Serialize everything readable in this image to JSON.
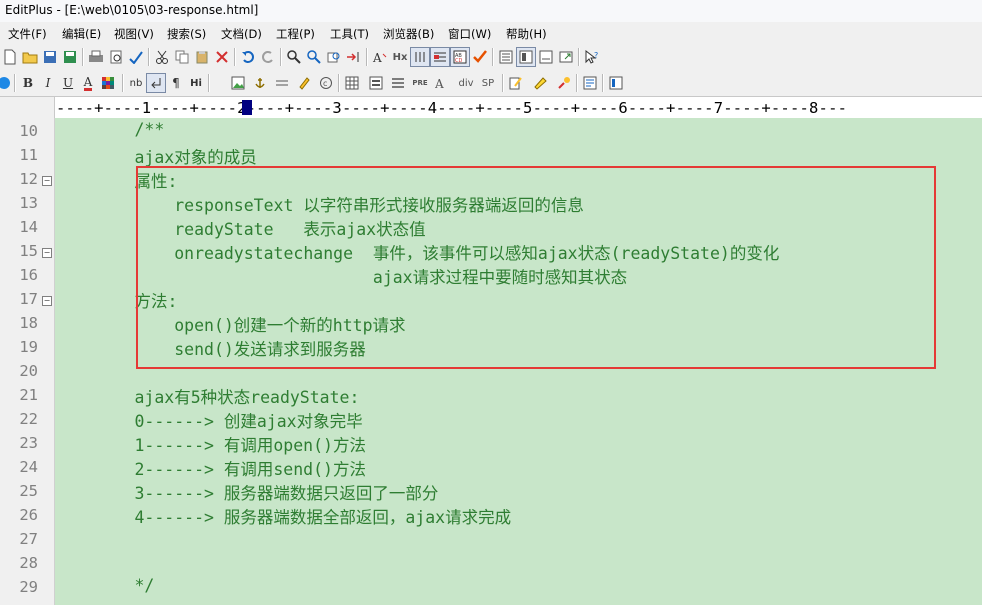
{
  "window": {
    "title": "EditPlus - [E:\\web\\0105\\03-response.html]"
  },
  "menu": [
    {
      "name": "file",
      "label": "文件(F)"
    },
    {
      "name": "edit",
      "label": "编辑(E)"
    },
    {
      "name": "view",
      "label": "视图(V)"
    },
    {
      "name": "search",
      "label": "搜索(S)"
    },
    {
      "name": "document",
      "label": "文档(D)"
    },
    {
      "name": "project",
      "label": "工程(P)"
    },
    {
      "name": "tools",
      "label": "工具(T)"
    },
    {
      "name": "browser",
      "label": "浏览器(B)"
    },
    {
      "name": "window",
      "label": "窗口(W)"
    },
    {
      "name": "help",
      "label": "帮助(H)"
    }
  ],
  "toolbar2_text": {
    "bold": "B",
    "italic": "I",
    "underline": "U",
    "color": "A",
    "nb": "nb",
    "para": "¶",
    "hi": "Hi",
    "pre": "PRE",
    "div": "div",
    "sp": "SP",
    "hx": "Hx"
  },
  "ruler": {
    "text": "----+----1----+----2----+----3----+----4----+----5----+----6----+----7----+----8---"
  },
  "editor": {
    "lines": [
      {
        "num": "10",
        "text": "        /**"
      },
      {
        "num": "11",
        "text": "        ajax对象的成员"
      },
      {
        "num": "12",
        "text": "        属性:"
      },
      {
        "num": "13",
        "text": "            responseText 以字符串形式接收服务器端返回的信息"
      },
      {
        "num": "14",
        "text": "            readyState   表示ajax状态值"
      },
      {
        "num": "15",
        "text": "            onreadystatechange  事件，该事件可以感知ajax状态(readyState)的变化"
      },
      {
        "num": "16",
        "text": "                                ajax请求过程中要随时感知其状态"
      },
      {
        "num": "17",
        "text": "        方法:"
      },
      {
        "num": "18",
        "text": "            open()创建一个新的http请求"
      },
      {
        "num": "19",
        "text": "            send()发送请求到服务器"
      },
      {
        "num": "20",
        "text": ""
      },
      {
        "num": "21",
        "text": "        ajax有5种状态readyState:"
      },
      {
        "num": "22",
        "text": "        0------> 创建ajax对象完毕"
      },
      {
        "num": "23",
        "text": "        1------> 有调用open()方法"
      },
      {
        "num": "24",
        "text": "        2------> 有调用send()方法"
      },
      {
        "num": "25",
        "text": "        3------> 服务器端数据只返回了一部分"
      },
      {
        "num": "26",
        "text": "        4------> 服务器端数据全部返回，ajax请求完成"
      },
      {
        "num": "27",
        "text": ""
      },
      {
        "num": "28",
        "text": ""
      },
      {
        "num": "29",
        "text": "        */"
      }
    ]
  },
  "colors": {
    "code_bg": "#c8e6c9",
    "code_text": "#2e7d32",
    "highlight_box": "#e53935"
  }
}
